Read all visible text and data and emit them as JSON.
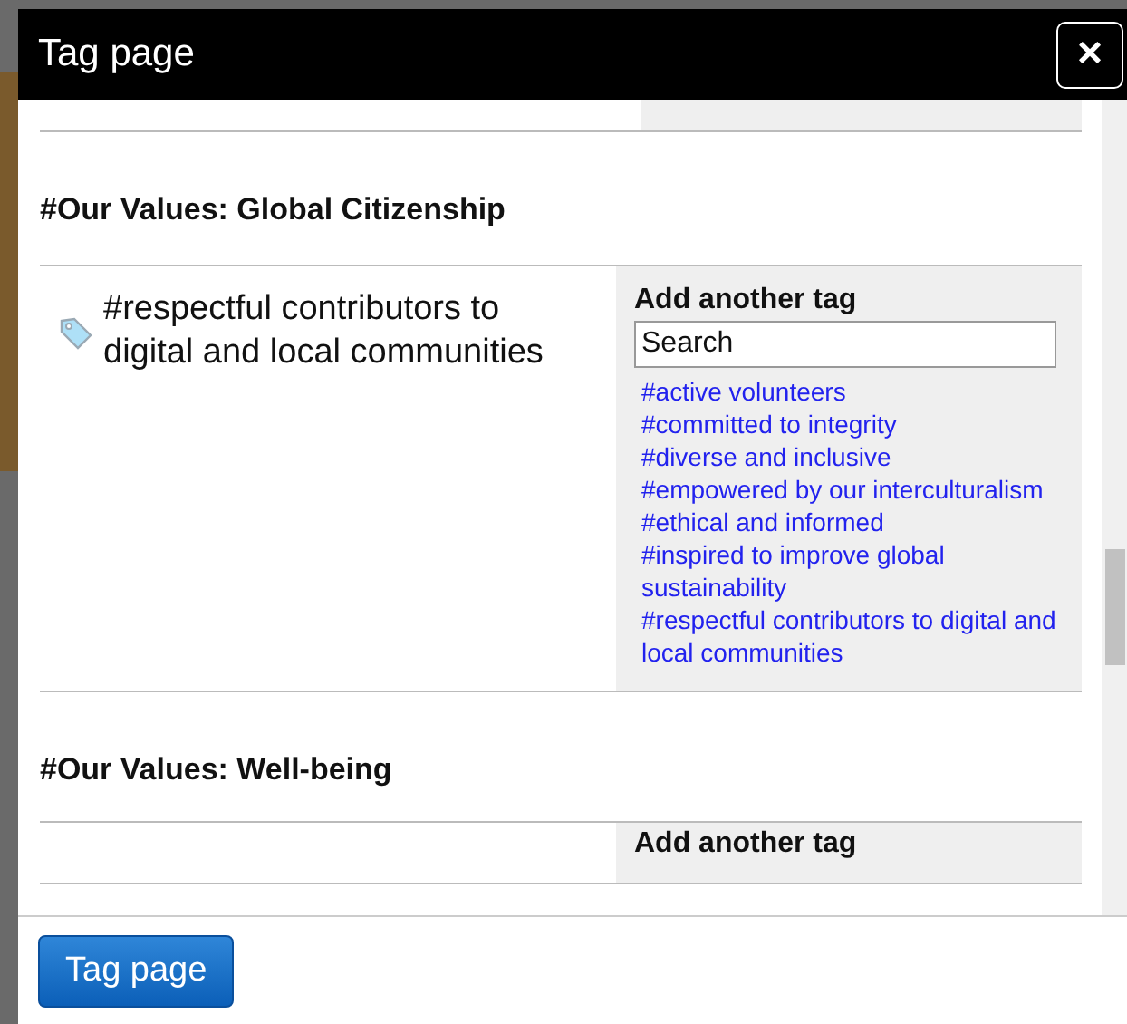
{
  "dialog": {
    "title": "Tag page",
    "close_label": "×"
  },
  "sections": [
    {
      "heading": "#Our Values: Global Citizenship",
      "tag": "#respectful contributors to digital and local communities",
      "add_label": "Add another tag",
      "search": {
        "placeholder": "Search"
      },
      "suggestions": [
        "#active volunteers",
        "#committed to integrity",
        "#diverse and inclusive",
        "#empowered by our interculturalism",
        "#ethical and informed",
        "#inspired to improve global sustainability",
        "#respectful contributors to digital and local communities"
      ]
    },
    {
      "heading": "#Our Values: Well-being",
      "add_label": "Add another tag"
    }
  ],
  "footer": {
    "button": "Tag page"
  }
}
